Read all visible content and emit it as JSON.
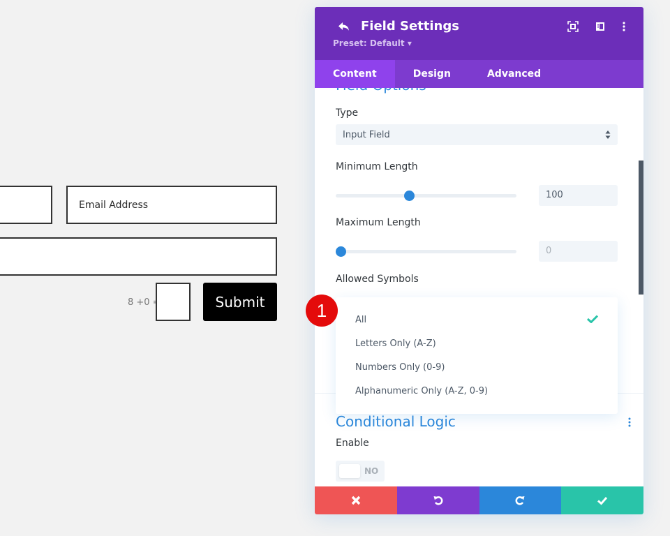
{
  "form": {
    "email_placeholder": "Email Address",
    "captcha_label": "8 +0 =",
    "submit_label": "Submit"
  },
  "panel": {
    "title": "Field Settings",
    "preset": "Preset: Default ▾",
    "header_icons": [
      "expand-icon",
      "split-view-icon",
      "more-options-icon"
    ],
    "tabs": [
      {
        "label": "Content",
        "active": true
      },
      {
        "label": "Design",
        "active": false
      },
      {
        "label": "Advanced",
        "active": false
      }
    ],
    "section_title": "Field Options",
    "type": {
      "label": "Type",
      "value": "Input Field"
    },
    "min_length": {
      "label": "Minimum Length",
      "value": "100",
      "slider_fraction": 0.4
    },
    "max_length": {
      "label": "Maximum Length",
      "value": "0",
      "slider_fraction": 0.0
    },
    "allowed_symbols": {
      "label": "Allowed Symbols",
      "options": [
        "All",
        "Letters Only (A-Z)",
        "Numbers Only (0-9)",
        "Alphanumeric Only (A-Z, 0-9)"
      ],
      "selected": "All"
    },
    "conditional_logic": {
      "title": "Conditional Logic",
      "enable_label": "Enable",
      "toggle_value": "NO"
    },
    "footer": {
      "buttons": [
        {
          "name": "cancel",
          "color": "#ef5555"
        },
        {
          "name": "undo",
          "color": "#7e3bd0"
        },
        {
          "name": "redo",
          "color": "#2b87da"
        },
        {
          "name": "save",
          "color": "#29c4a9"
        }
      ]
    }
  },
  "annotation": {
    "badge_number": "1",
    "badge_color": "#e40b0b"
  },
  "colors": {
    "header_purple": "#6c2eb9",
    "tab_bar": "#7d3bcf",
    "tab_active": "#8f42ec",
    "accent_blue": "#2b87da",
    "check_teal": "#29c4a9"
  }
}
